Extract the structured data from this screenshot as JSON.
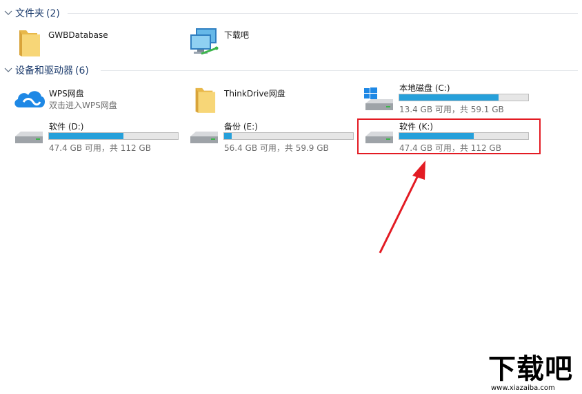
{
  "groups": {
    "folders": {
      "title": "文件夹",
      "count": "(2)"
    },
    "devices": {
      "title": "设备和驱动器",
      "count": "(6)"
    }
  },
  "folders": [
    {
      "name": "GWBDatabase",
      "icon": "folder-icon"
    },
    {
      "name": "下载吧",
      "icon": "network-computers-icon"
    }
  ],
  "devices": {
    "wps": {
      "name": "WPS网盘",
      "sub": "双击进入WPS网盘",
      "icon": "wps-cloud-icon"
    },
    "thinkdrive": {
      "name": "ThinkDrive网盘",
      "icon": "folder-icon"
    },
    "drive_c": {
      "name": "本地磁盘 (C:)",
      "sub": "13.4 GB 可用，共 59.1 GB",
      "used_fraction": 0.77,
      "icon": "windows-drive-icon"
    },
    "drive_d": {
      "name": "软件 (D:)",
      "sub": "47.4 GB 可用，共 112 GB",
      "used_fraction": 0.58,
      "icon": "drive-icon"
    },
    "drive_e": {
      "name": "备份 (E:)",
      "sub": "56.4 GB 可用，共 59.9 GB",
      "used_fraction": 0.06,
      "icon": "drive-icon"
    },
    "drive_k": {
      "name": "软件 (K:)",
      "sub": "47.4 GB 可用，共 112 GB",
      "used_fraction": 0.58,
      "icon": "drive-icon"
    }
  },
  "colors": {
    "bar_fill": "#26a0da",
    "highlight": "#e31b23",
    "arrow": "#e31b23",
    "group_title": "#1e3d6e"
  },
  "watermark": {
    "main": "下载吧",
    "url": "www.xiazaiba.com"
  }
}
